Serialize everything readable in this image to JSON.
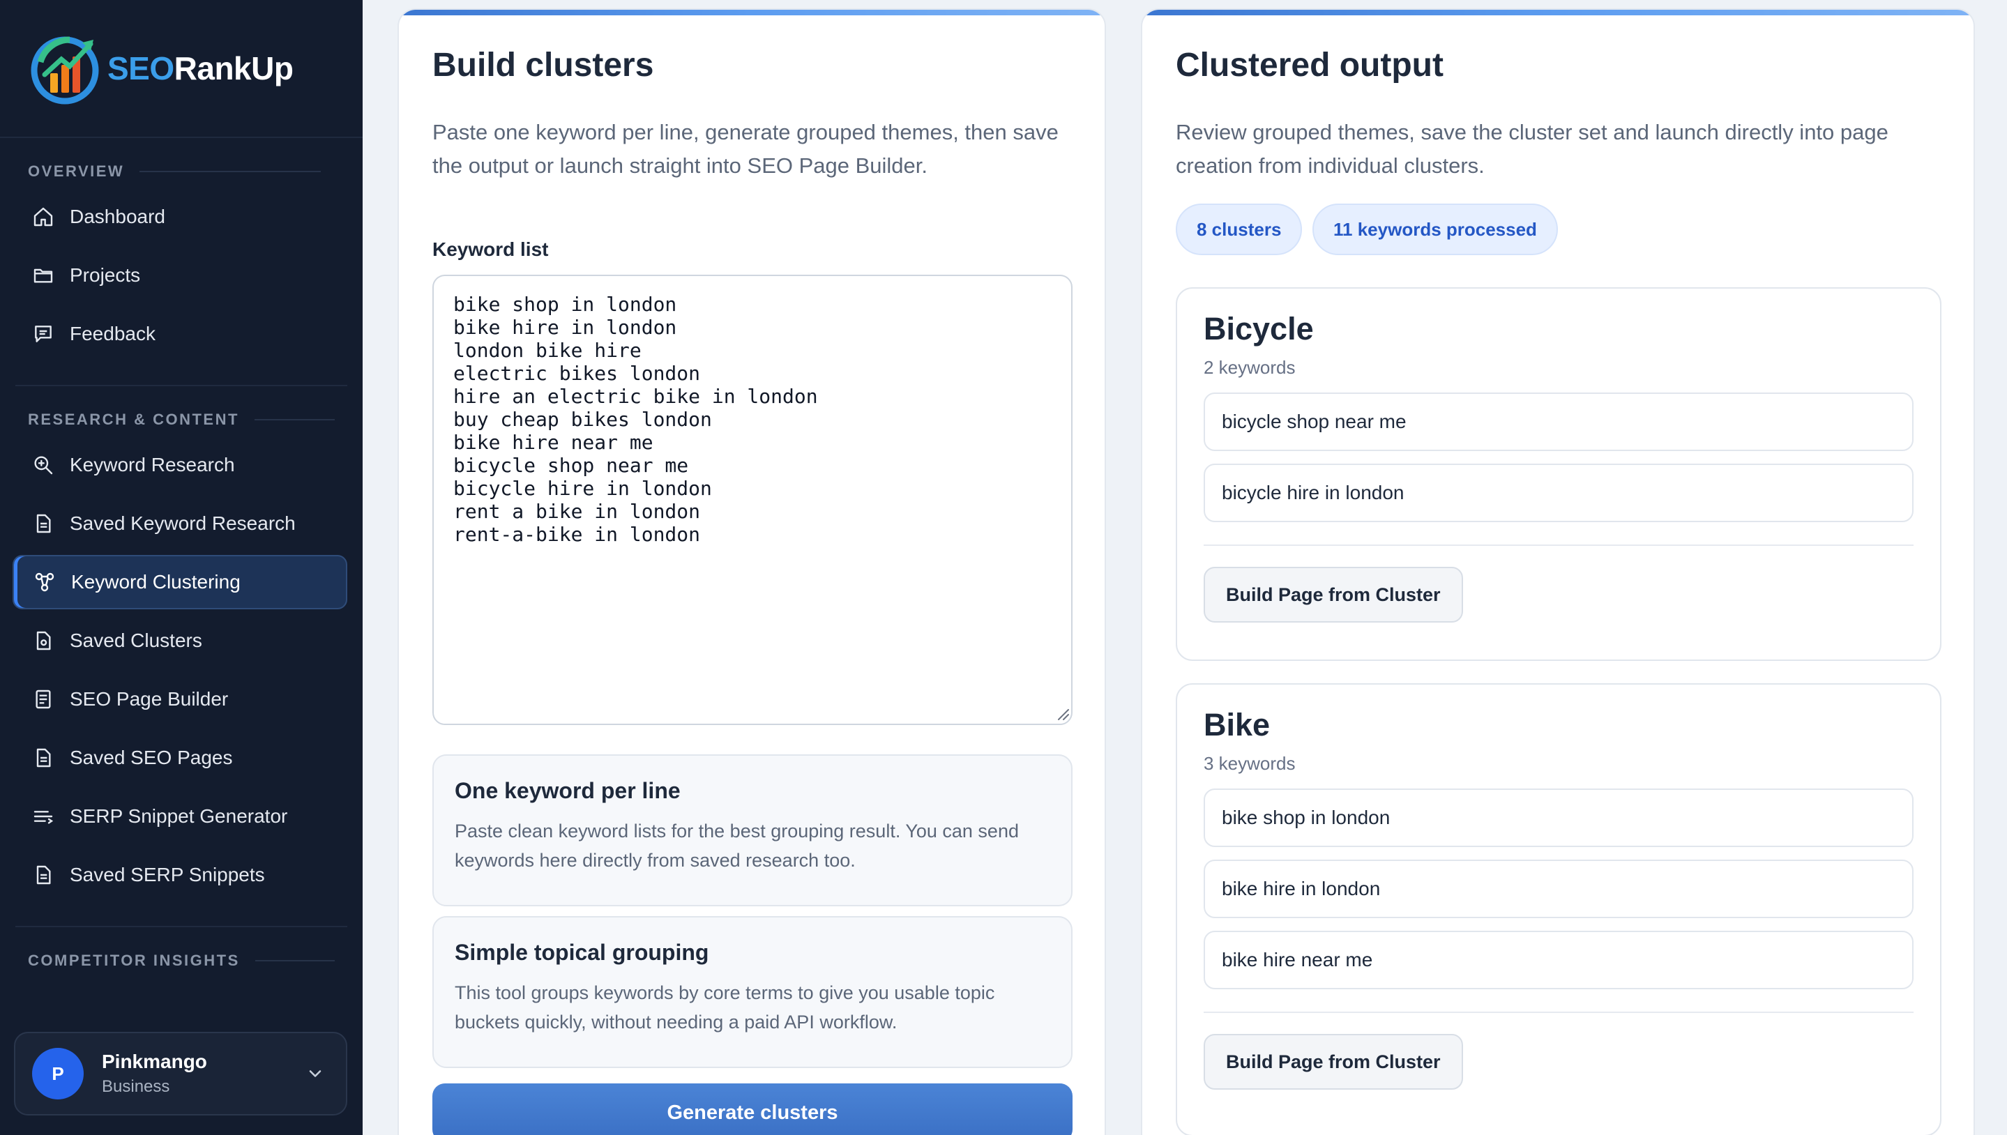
{
  "brand": {
    "seo": "SEO",
    "rank": "RankUp"
  },
  "sidebar": {
    "sections": {
      "overview": "OVERVIEW",
      "research": "RESEARCH & CONTENT",
      "competitor": "COMPETITOR INSIGHTS"
    },
    "overview_items": [
      {
        "label": "Dashboard",
        "icon": "home-icon"
      },
      {
        "label": "Projects",
        "icon": "folder-icon"
      },
      {
        "label": "Feedback",
        "icon": "message-icon"
      }
    ],
    "research_items": [
      {
        "label": "Keyword Research",
        "icon": "search-icon"
      },
      {
        "label": "Saved Keyword Research",
        "icon": "document-icon"
      },
      {
        "label": "Keyword Clustering",
        "icon": "cluster-icon",
        "active": true
      },
      {
        "label": "Saved Clusters",
        "icon": "document-icon"
      },
      {
        "label": "SEO Page Builder",
        "icon": "page-icon"
      },
      {
        "label": "Saved SEO Pages",
        "icon": "document-icon"
      },
      {
        "label": "SERP Snippet Generator",
        "icon": "lines-icon"
      },
      {
        "label": "Saved SERP Snippets",
        "icon": "document-icon"
      }
    ],
    "user": {
      "initial": "P",
      "name": "Pinkmango",
      "plan": "Business"
    }
  },
  "build": {
    "title": "Build clusters",
    "subtitle": "Paste one keyword per line, generate grouped themes, then save the output or launch straight into SEO Page Builder.",
    "keyword_label": "Keyword list",
    "keywords": "bike shop in london\nbike hire in london\nlondon bike hire\nelectric bikes london\nhire an electric bike in london\nbuy cheap bikes london\nbike hire near me\nbicycle shop near me\nbicycle hire in london\nrent a bike in london\nrent-a-bike in london",
    "info1_title": "One keyword per line",
    "info1_text": "Paste clean keyword lists for the best grouping result. You can send keywords here directly from saved research too.",
    "info2_title": "Simple topical grouping",
    "info2_text": "This tool groups keywords by core terms to give you usable topic buckets quickly, without needing a paid API workflow.",
    "generate_label": "Generate clusters"
  },
  "output": {
    "title": "Clustered output",
    "subtitle": "Review grouped themes, save the cluster set and launch directly into page creation from individual clusters.",
    "chip_clusters": "8 clusters",
    "chip_keywords": "11 keywords processed",
    "build_label": "Build Page from Cluster",
    "clusters": [
      {
        "name": "Bicycle",
        "count": "2 keywords",
        "keywords": [
          "bicycle shop near me",
          "bicycle hire in london"
        ]
      },
      {
        "name": "Bike",
        "count": "3 keywords",
        "keywords": [
          "bike shop in london",
          "bike hire in london",
          "bike hire near me"
        ]
      }
    ]
  }
}
